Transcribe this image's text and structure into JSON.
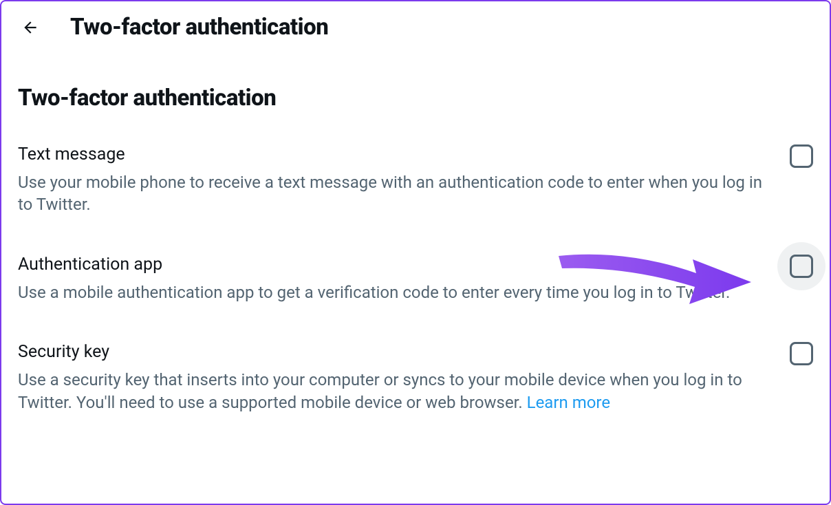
{
  "header": {
    "title": "Two-factor authentication"
  },
  "section": {
    "title": "Two-factor authentication"
  },
  "options": [
    {
      "title": "Text message",
      "description": "Use your mobile phone to receive a text message with an authentication code to enter when you log in to Twitter.",
      "checked": false,
      "hovered": false
    },
    {
      "title": "Authentication app",
      "description": "Use a mobile authentication app to get a verification code to enter every time you log in to Twitter.",
      "checked": false,
      "hovered": true
    },
    {
      "title": "Security key",
      "description": "Use a security key that inserts into your computer or syncs to your mobile device when you log in to Twitter. You'll need to use a supported mobile device or web browser. ",
      "learn_more": "Learn more",
      "checked": false,
      "hovered": false
    }
  ],
  "annotation": {
    "arrow_color": "#8b3aed"
  }
}
